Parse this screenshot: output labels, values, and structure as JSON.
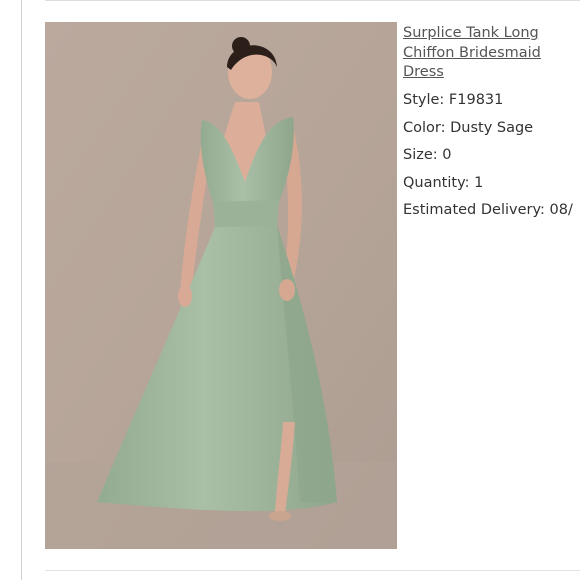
{
  "product": {
    "name": "Surplice Tank Long Chiffon Bridesmaid Dress",
    "photo_alt": "Model wearing a dusty sage sleeveless V-neck floor-length chiffon gown",
    "style": "Style: F19831",
    "color": "Color: Dusty Sage",
    "size": "Size: 0",
    "quantity": "Quantity: 1",
    "delivery": "Estimated Delivery: 08/"
  },
  "colors": {
    "backdrop": "#b9a89d",
    "dress": "#a3b9a0",
    "link_text": "#555555",
    "body_text": "#333333"
  }
}
